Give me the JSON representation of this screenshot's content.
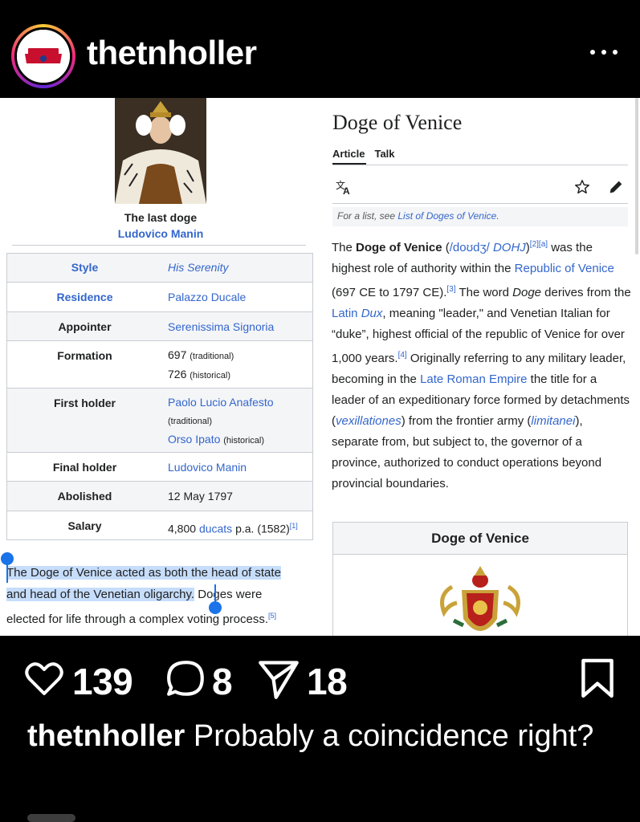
{
  "header": {
    "avatar_text": "TN HOLLER",
    "username": "thetnholler",
    "more_icon": "more-horizontal-icon"
  },
  "infobox": {
    "caption_title": "The last doge",
    "caption_name": "Ludovico Manin",
    "rows": [
      {
        "label": "Style",
        "value": "His Serenity"
      },
      {
        "label": "Residence",
        "value": "Palazzo Ducale"
      },
      {
        "label": "Appointer",
        "value": "Serenissima Signoria"
      },
      {
        "label": "Formation",
        "value1": "697",
        "note1": "(traditional)",
        "value2": "726",
        "note2": "(historical)"
      },
      {
        "label": "First holder",
        "value1": "Paolo Lucio Anafesto",
        "note1": "(traditional)",
        "value2": "Orso Ipato",
        "note2": "(historical)"
      },
      {
        "label": "Final holder",
        "value": "Ludovico Manin"
      },
      {
        "label": "Abolished",
        "value": "12 May 1797"
      },
      {
        "label": "Salary",
        "pre": "4,800 ",
        "link": "ducats",
        "post": " p.a. (1582)",
        "ref": "[1]"
      }
    ]
  },
  "selection": {
    "line1": "The Doge of Venice acted as both the head of state",
    "line2a": "and head of the Venetian oligarchy.",
    "line2b": " Doges were",
    "line3": "elected for life through a complex voting process.",
    "ref": "[5]"
  },
  "article": {
    "title": "Doge of Venice",
    "tabs": [
      "Article",
      "Talk"
    ],
    "translate_icon": "translate-icon",
    "hatnote_prefix": "For a list, see ",
    "hatnote_link": "List of Doges of Venice",
    "hatnote_suffix": ".",
    "infobox_title": "Doge of Venice"
  },
  "actions": {
    "likes": "139",
    "comments": "8",
    "shares": "18"
  },
  "caption": {
    "user": "thetnholler",
    "text": " Probably a coincidence right?"
  },
  "colors": {
    "link": "#3366cc",
    "selection": "#c6ddfb",
    "handle": "#1a73e8"
  }
}
